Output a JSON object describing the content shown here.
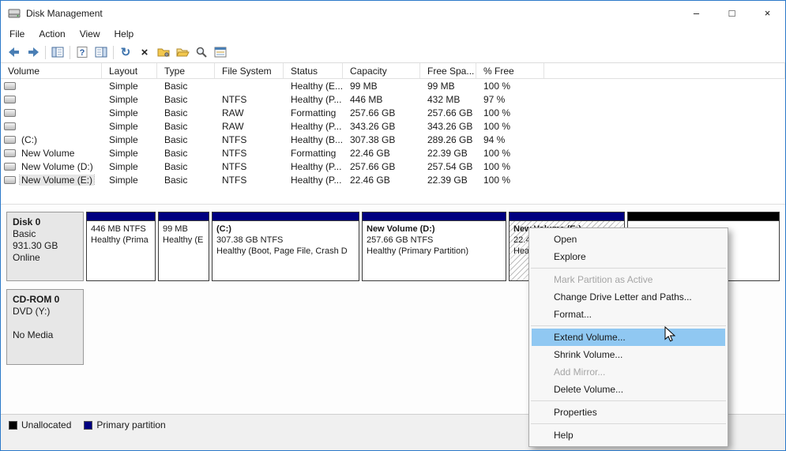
{
  "window": {
    "title": "Disk Management",
    "minimize": "–",
    "maximize": "□",
    "close": "×"
  },
  "menubar": {
    "file": "File",
    "action": "Action",
    "view": "View",
    "help": "Help"
  },
  "toolbar": {
    "icons": [
      "back-arrow",
      "forward-arrow",
      "show-console-tree",
      "help",
      "show-action-pane",
      "refresh",
      "delete",
      "folder-properties",
      "open-folder",
      "search",
      "export-list"
    ],
    "refresh_glyph": "↻",
    "delete_glyph": "×"
  },
  "volumes": {
    "columns": {
      "volume": "Volume",
      "layout": "Layout",
      "type": "Type",
      "fs": "File System",
      "status": "Status",
      "capacity": "Capacity",
      "free": "Free Spa...",
      "pctfree": "% Free"
    },
    "rows": [
      {
        "volume": "",
        "layout": "Simple",
        "type": "Basic",
        "fs": "",
        "status": "Healthy (E...",
        "capacity": "99 MB",
        "free": "99 MB",
        "pctfree": "100 %"
      },
      {
        "volume": "",
        "layout": "Simple",
        "type": "Basic",
        "fs": "NTFS",
        "status": "Healthy (P...",
        "capacity": "446 MB",
        "free": "432 MB",
        "pctfree": "97 %"
      },
      {
        "volume": "",
        "layout": "Simple",
        "type": "Basic",
        "fs": "RAW",
        "status": "Formatting",
        "capacity": "257.66 GB",
        "free": "257.66 GB",
        "pctfree": "100 %"
      },
      {
        "volume": "",
        "layout": "Simple",
        "type": "Basic",
        "fs": "RAW",
        "status": "Healthy (P...",
        "capacity": "343.26 GB",
        "free": "343.26 GB",
        "pctfree": "100 %"
      },
      {
        "volume": "(C:)",
        "layout": "Simple",
        "type": "Basic",
        "fs": "NTFS",
        "status": "Healthy (B...",
        "capacity": "307.38 GB",
        "free": "289.26 GB",
        "pctfree": "94 %"
      },
      {
        "volume": "New Volume",
        "layout": "Simple",
        "type": "Basic",
        "fs": "NTFS",
        "status": "Formatting",
        "capacity": "22.46 GB",
        "free": "22.39 GB",
        "pctfree": "100 %"
      },
      {
        "volume": "New Volume (D:)",
        "layout": "Simple",
        "type": "Basic",
        "fs": "NTFS",
        "status": "Healthy (P...",
        "capacity": "257.66 GB",
        "free": "257.54 GB",
        "pctfree": "100 %"
      },
      {
        "volume": "New Volume (E:)",
        "layout": "Simple",
        "type": "Basic",
        "fs": "NTFS",
        "status": "Healthy (P...",
        "capacity": "22.46 GB",
        "free": "22.39 GB",
        "pctfree": "100 %"
      }
    ]
  },
  "disk0": {
    "name": "Disk 0",
    "type": "Basic",
    "size": "931.30 GB",
    "status": "Online",
    "partitions": [
      {
        "title": "",
        "line1": "446 MB NTFS",
        "line2": "Healthy (Prima"
      },
      {
        "title": "",
        "line1": "99 MB",
        "line2": "Healthy (E"
      },
      {
        "title": "(C:)",
        "line1": "307.38 GB NTFS",
        "line2": "Healthy (Boot, Page File, Crash D"
      },
      {
        "title": "New Volume  (D:)",
        "line1": "257.66 GB NTFS",
        "line2": "Healthy (Primary Partition)"
      },
      {
        "title": "New Volume (E:)",
        "line1": "22.46 GB NTFS",
        "line2": "Healthy (Primary Partition)"
      }
    ]
  },
  "cdrom": {
    "name": "CD-ROM 0",
    "type": "DVD (Y:)",
    "status": "No Media"
  },
  "context_menu": {
    "items": [
      {
        "label": "Open"
      },
      {
        "label": "Explore"
      },
      {
        "label": "Mark Partition as Active"
      },
      {
        "label": "Change Drive Letter and Paths..."
      },
      {
        "label": "Format..."
      },
      {
        "label": "Extend Volume..."
      },
      {
        "label": "Shrink Volume..."
      },
      {
        "label": "Add Mirror..."
      },
      {
        "label": "Delete Volume..."
      },
      {
        "label": "Properties"
      },
      {
        "label": "Help"
      }
    ]
  },
  "legend": {
    "unallocated": "Unallocated",
    "primary": "Primary partition"
  },
  "colors": {
    "partition_band": "#000080",
    "unallocated_band": "#000000",
    "menu_highlight": "#90c8f2",
    "window_border": "#2b79c9"
  }
}
